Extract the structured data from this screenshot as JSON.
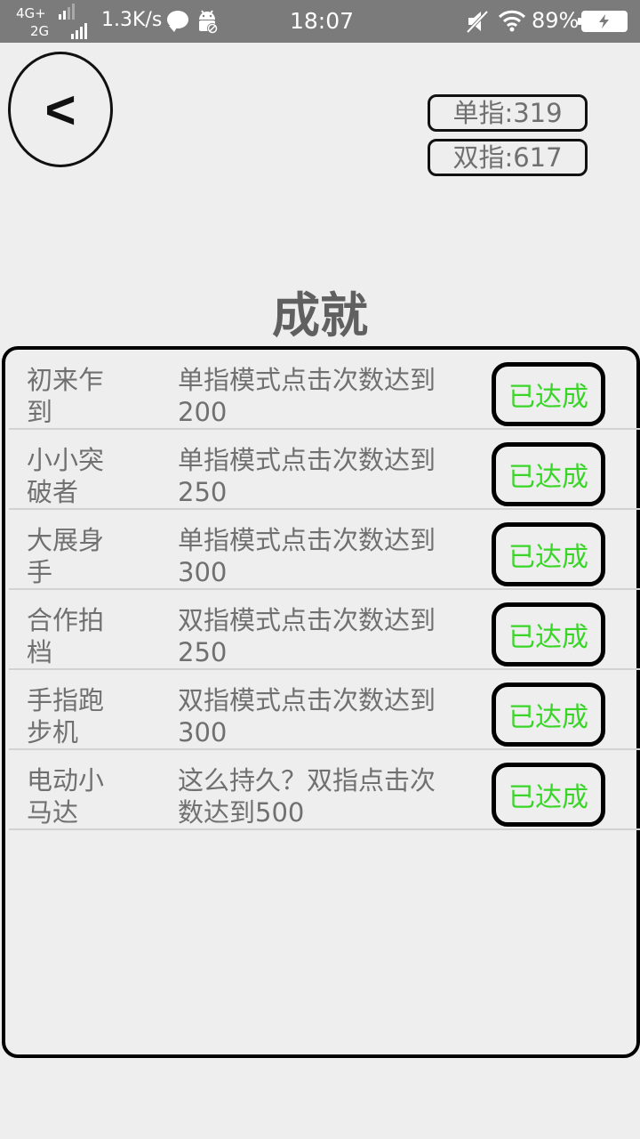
{
  "status_bar": {
    "network_top": "4G+",
    "network_bottom": "2G",
    "speed": "1.3K/s",
    "time": "18:07",
    "battery": "89%"
  },
  "header": {
    "back_label": "<",
    "single_stat": "单指:319",
    "double_stat": "双指:617"
  },
  "title": "成就",
  "achievements": [
    {
      "name": "初来乍到",
      "desc": "单指模式点击次数达到200",
      "status": "已达成"
    },
    {
      "name": "小小突破者",
      "desc": "单指模式点击次数达到250",
      "status": "已达成"
    },
    {
      "name": "大展身手",
      "desc": "单指模式点击次数达到300",
      "status": "已达成"
    },
    {
      "name": "合作拍档",
      "desc": "双指模式点击次数达到250",
      "status": "已达成"
    },
    {
      "name": "手指跑步机",
      "desc": "双指模式点击次数达到300",
      "status": "已达成"
    },
    {
      "name": "电动小马达",
      "desc": "这么持久？双指点击次数达到500",
      "status": "已达成"
    }
  ],
  "colors": {
    "status_bar": "#7b7b7b",
    "background": "#eeeeee",
    "text": "#707070",
    "achieved": "#39d628"
  }
}
